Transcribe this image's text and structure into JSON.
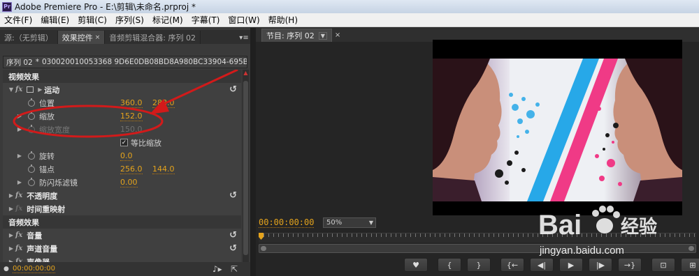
{
  "window": {
    "app_icon": "Pr",
    "title": "Adobe Premiere Pro - E:\\剪辑\\未命名.prproj *"
  },
  "menu": [
    "文件(F)",
    "编辑(E)",
    "剪辑(C)",
    "序列(S)",
    "标记(M)",
    "字幕(T)",
    "窗口(W)",
    "帮助(H)"
  ],
  "left_panel": {
    "tabs": [
      {
        "label": "源:（无剪辑）",
        "active": false
      },
      {
        "label": "效果控件",
        "active": true,
        "close": "×"
      },
      {
        "label": "音频剪辑混合器: 序列 02",
        "active": false
      }
    ],
    "panel_menu": "▾≡",
    "sequence": "序列 02",
    "sequence_sep": "*",
    "clip": "030020010053368 9D6E0DB08BD8A980BC33904-695B-7A9F...",
    "video_section": "视频效果",
    "motion": {
      "fx": "fx",
      "label": "运动",
      "position_label": "位置",
      "position_x": "360.0",
      "position_y": "288.0",
      "scale_label": "缩放",
      "scale": "152.0",
      "scale_width_label": "缩放宽度",
      "scale_width": "150.0",
      "uniform_label": "等比缩放",
      "uniform_checked": "✓",
      "rotation_label": "旋转",
      "rotation": "0.0",
      "anchor_label": "锚点",
      "anchor_x": "256.0",
      "anchor_y": "144.0",
      "antiflicker_label": "防闪烁滤镜",
      "antiflicker": "0.00"
    },
    "opacity_label": "不透明度",
    "time_remap_label": "时间重映射",
    "audio_section": "音频效果",
    "volume_label": "音量",
    "channel_volume_label": "声道音量",
    "panner_label": "声像器",
    "reset_icon": "↺",
    "bottom_time": "00:00:00:00"
  },
  "program_monitor": {
    "tab_label": "节目: 序列 02",
    "tab_close": "×",
    "timecode": "00:00:00:00",
    "zoom": "50%"
  },
  "transport": [
    "♥",
    "{",
    "}",
    "{←",
    "◀|",
    "▶",
    "|▶",
    "→}",
    "⊡",
    "⊞",
    "⊟"
  ],
  "watermark": {
    "brand": "Bai",
    "brand2": "经验",
    "url": "jingyan.baidu.com"
  },
  "colors": {
    "accent_orange": "#e4a31c",
    "annotation_red": "#d21a1a",
    "stripe_blue": "#27a8e8",
    "stripe_pink": "#f03a86"
  }
}
